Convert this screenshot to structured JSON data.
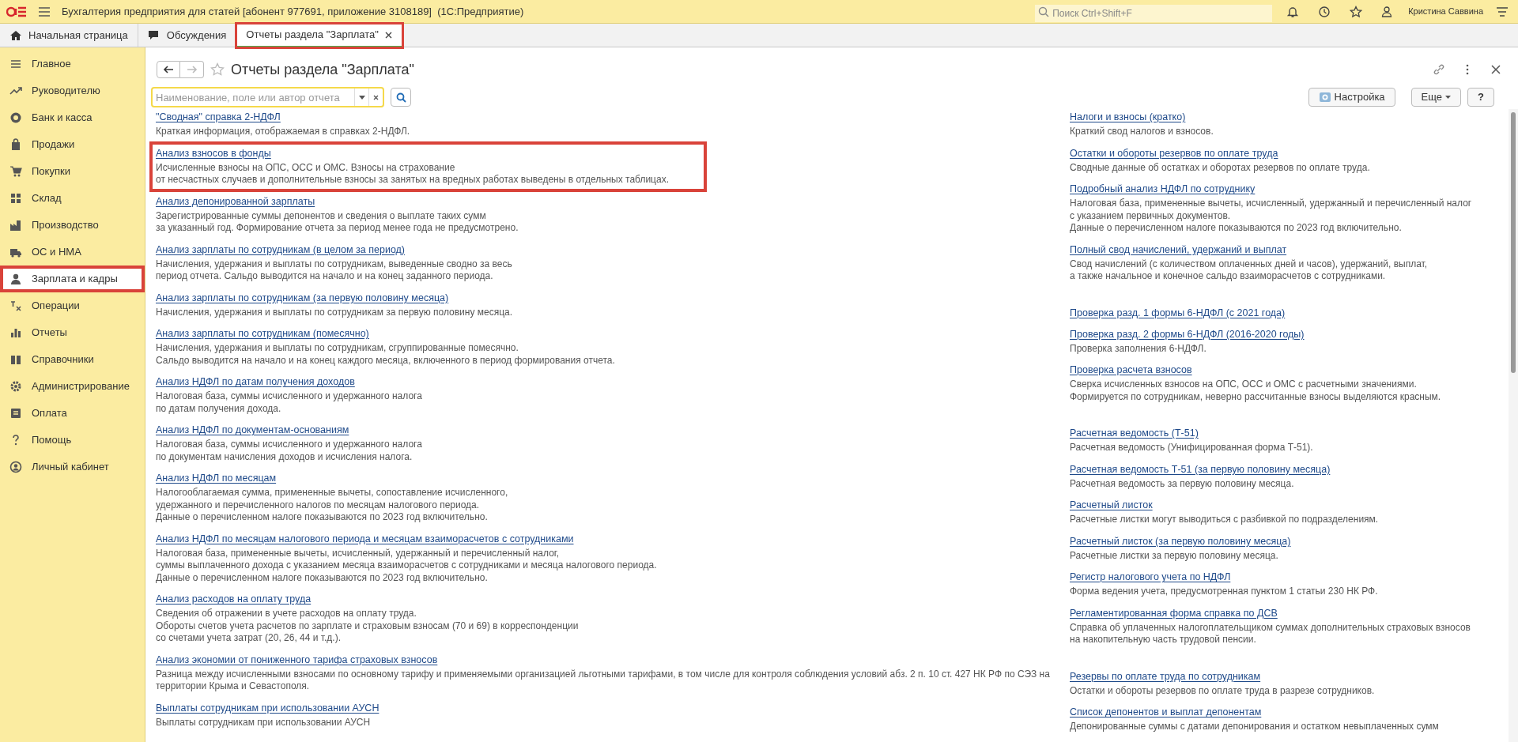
{
  "app_bar": {
    "title": "Бухгалтерия предприятия для статей [абонент 977691, приложение 3108189]  (1С:Предприятие)",
    "search_placeholder": "Поиск Ctrl+Shift+F",
    "user": "Кристина Саввина"
  },
  "tabs": [
    {
      "label": "Начальная страница",
      "kind": "home",
      "selected": false,
      "annotated": false
    },
    {
      "label": "Обсуждения",
      "kind": "chat",
      "selected": false,
      "annotated": false
    },
    {
      "label": "Отчеты раздела \"Зарплата\"",
      "kind": "doc",
      "selected": true,
      "annotated": true
    }
  ],
  "sidebar": {
    "items": [
      {
        "label": "Главное",
        "kind": "menu",
        "selected": false,
        "annotated": false
      },
      {
        "label": "Руководителю",
        "kind": "trend",
        "selected": false,
        "annotated": false
      },
      {
        "label": "Банк и касса",
        "kind": "coin",
        "selected": false,
        "annotated": false
      },
      {
        "label": "Продажи",
        "kind": "bag",
        "selected": false,
        "annotated": false
      },
      {
        "label": "Покупки",
        "kind": "cart",
        "selected": false,
        "annotated": false
      },
      {
        "label": "Склад",
        "kind": "grid",
        "selected": false,
        "annotated": false
      },
      {
        "label": "Производство",
        "kind": "factory",
        "selected": false,
        "annotated": false
      },
      {
        "label": "ОС и НМА",
        "kind": "truck",
        "selected": false,
        "annotated": false
      },
      {
        "label": "Зарплата и кадры",
        "kind": "person",
        "selected": true,
        "annotated": true
      },
      {
        "label": "Операции",
        "kind": "ops",
        "selected": false,
        "annotated": false
      },
      {
        "label": "Отчеты",
        "kind": "chart",
        "selected": false,
        "annotated": false
      },
      {
        "label": "Справочники",
        "kind": "book",
        "selected": false,
        "annotated": false
      },
      {
        "label": "Администрирование",
        "kind": "gear",
        "selected": false,
        "annotated": false
      },
      {
        "label": "Оплата",
        "kind": "card",
        "selected": false,
        "annotated": false
      },
      {
        "label": "Помощь",
        "kind": "help",
        "selected": false,
        "annotated": false
      },
      {
        "label": "Личный кабинет",
        "kind": "account",
        "selected": false,
        "annotated": false
      }
    ]
  },
  "page": {
    "title": "Отчеты раздела \"Зарплата\"",
    "search_placeholder": "Наименование, поле или автор отчета",
    "buttons": [
      "Настройка",
      "Еще",
      "?"
    ]
  },
  "reports_left": [
    {
      "title": "\"Сводная\" справка 2-НДФЛ",
      "description": "Краткая информация, отображаемая в справках 2-НДФЛ.",
      "annotated": false
    },
    {
      "title": "Анализ взносов в фонды",
      "description": "Исчисленные взносы на ОПС, ОСС и ОМС. Взносы на страхование\nот несчастных случаев и дополнительные взносы за занятых на вредных работах выведены в отдельных таблицах.",
      "annotated": true
    },
    {
      "title": "Анализ депонированной зарплаты",
      "description": "Зарегистрированные суммы депонентов и сведения о выплате таких сумм\nза указанный год. Формирование отчета за период менее года не предусмотрено.",
      "annotated": false
    },
    {
      "title": "Анализ зарплаты по сотрудникам (в целом за период)",
      "description": "Начисления, удержания и выплаты по сотрудникам, выведенные сводно за весь\nпериод отчета. Сальдо выводится на начало и на конец заданного периода.",
      "annotated": false
    },
    {
      "title": "Анализ зарплаты по сотрудникам (за первую половину месяца)",
      "description": "Начисления, удержания и выплаты по сотрудникам за первую половину месяца.",
      "annotated": false
    },
    {
      "title": "Анализ зарплаты по сотрудникам (помесячно)",
      "description": "Начисления, удержания и выплаты по сотрудникам, сгруппированные помесячно.\nСальдо выводится на начало и на конец каждого месяца, включенного в период формирования отчета.",
      "annotated": false
    },
    {
      "title": "Анализ НДФЛ по датам получения доходов",
      "description": "Налоговая база, суммы исчисленного и удержанного налога\nпо датам получения дохода.",
      "annotated": false
    },
    {
      "title": "Анализ НДФЛ по документам-основаниям",
      "description": "Налоговая база, суммы исчисленного и удержанного налога\nпо документам начисления доходов и исчисления налога.",
      "annotated": false
    },
    {
      "title": "Анализ НДФЛ по месяцам",
      "description": "Налогооблагаемая сумма, примененные вычеты, сопоставление исчисленного,\nудержанного и перечисленного налогов по месяцам налогового периода.\nДанные о перечисленном налоге показываются по 2023 год включительно.",
      "annotated": false
    },
    {
      "title": "Анализ НДФЛ по месяцам налогового периода и месяцам взаиморасчетов с сотрудниками",
      "description": "Налоговая база, примененные вычеты, исчисленный, удержанный и перечисленный налог,\nсуммы выплаченного дохода с указанием месяца взаиморасчетов с сотрудниками и месяца налогового периода.\nДанные о перечисленном налоге показываются по 2023 год включительно.",
      "annotated": false
    },
    {
      "title": "Анализ расходов на оплату труда",
      "description": "Сведения об отражении в учете расходов на оплату труда.\nОбороты счетов учета расчетов по зарплате и страховым взносам (70 и 69) в корреспонденции\nсо счетами учета затрат (20, 26, 44 и т.д.).",
      "annotated": false
    },
    {
      "title": "Анализ экономии от пониженного тарифа страховых взносов",
      "description": "Разница между исчисленными взносами по основному тарифу и применяемыми организацией льготными тарифами, в том числе для контроля соблюдения условий абз. 2 п. 10 ст. 427 НК РФ по СЭЗ на территории Крыма и Севастополя.",
      "annotated": false
    },
    {
      "title": "Выплаты сотрудникам при использовании АУСН",
      "description": "Выплаты сотрудникам при использовании АУСН",
      "annotated": false
    }
  ],
  "reports_right": [
    {
      "items": [
        {
          "title": "Налоги и взносы (кратко)",
          "description": "Краткий свод налогов и взносов."
        },
        {
          "title": "Остатки и обороты резервов по оплате труда",
          "description": "Сводные данные об остатках и оборотах резервов по оплате труда."
        },
        {
          "title": "Подробный анализ НДФЛ по сотруднику",
          "description": "Налоговая база, примененные вычеты, исчисленный, удержанный и перечисленный налог\nс указанием первичных документов.\nДанные о перечисленном налоге показываются по 2023 год включительно."
        },
        {
          "title": "Полный свод начислений, удержаний и выплат",
          "description": "Свод начислений (с количеством оплаченных дней и часов), удержаний, выплат,\nа также начальное и конечное сальдо взаиморасчетов с сотрудниками."
        }
      ]
    },
    {
      "items": [
        {
          "title": "Проверка разд. 1 формы 6-НДФЛ (с 2021 года)"
        },
        {
          "title": "Проверка разд. 2 формы 6-НДФЛ (2016-2020 годы)",
          "description": "Проверка заполнения 6-НДФЛ."
        },
        {
          "title": "Проверка расчета взносов",
          "description": "Сверка исчисленных взносов на ОПС, ОСС и ОМС с расчетными значениями.\nФормируется по сотрудникам, неверно рассчитанные взносы выделяются красным."
        }
      ]
    },
    {
      "items": [
        {
          "title": "Расчетная ведомость (Т-51)",
          "description": "Расчетная ведомость (Унифицированная форма Т-51)."
        },
        {
          "title": "Расчетная ведомость Т-51 (за первую половину месяца)",
          "description": "Расчетная ведомость за первую половину месяца."
        },
        {
          "title": "Расчетный листок",
          "description": "Расчетные листки могут выводиться с разбивкой по подразделениям."
        },
        {
          "title": "Расчетный листок (за первую половину месяца)",
          "description": "Расчетные листки за первую половину месяца."
        },
        {
          "title": "Регистр налогового учета по НДФЛ",
          "description": "Форма ведения учета, предусмотренная пунктом 1 статьи 230 НК РФ."
        },
        {
          "title": "Регламентированная форма справка по ДСВ",
          "description": "Справка об уплаченных налогоплательщиком суммах дополнительных страховых взносов\nна накопительную часть трудовой пенсии."
        }
      ]
    },
    {
      "items": [
        {
          "title": "Резервы по оплате труда по сотрудникам",
          "description": "Остатки и обороты резервов по оплате труда в разрезе сотрудников."
        },
        {
          "title": "Список депонентов и выплат депонентам",
          "description": "Депонированные суммы с датами депонирования и остатком невыплаченных сумм"
        }
      ]
    }
  ]
}
